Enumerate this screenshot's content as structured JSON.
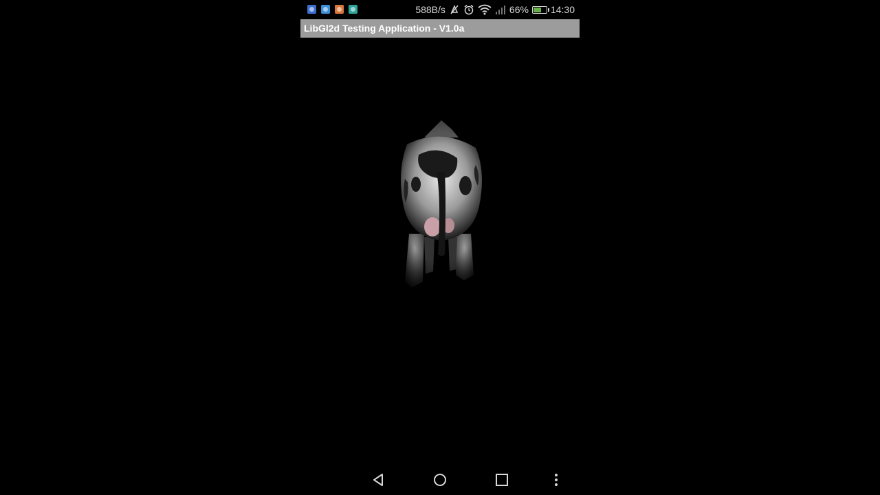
{
  "status_bar": {
    "notification_icons": [
      {
        "name": "app-notification-icon-1",
        "color": "#3d6fd1"
      },
      {
        "name": "app-notification-icon-2",
        "color": "#3a8fd8"
      },
      {
        "name": "mail-notification-icon",
        "color": "#d9763a"
      },
      {
        "name": "app-notification-icon-3",
        "color": "#2fa39a"
      }
    ],
    "network_speed": "588B/s",
    "battery_percent": "66%",
    "battery_level": 0.66,
    "time": "14:30",
    "icons": [
      "mute-icon",
      "alarm-icon",
      "wifi-icon",
      "signal-icon",
      "battery-icon"
    ]
  },
  "app": {
    "title": "LibGl2d Testing Application - V1.0a",
    "title_bar_color": "#9c9c9c"
  },
  "scene": {
    "object": "cow-3d-model"
  },
  "nav_bar": {
    "buttons": [
      "back-icon",
      "home-icon",
      "recents-icon",
      "menu-icon"
    ]
  }
}
